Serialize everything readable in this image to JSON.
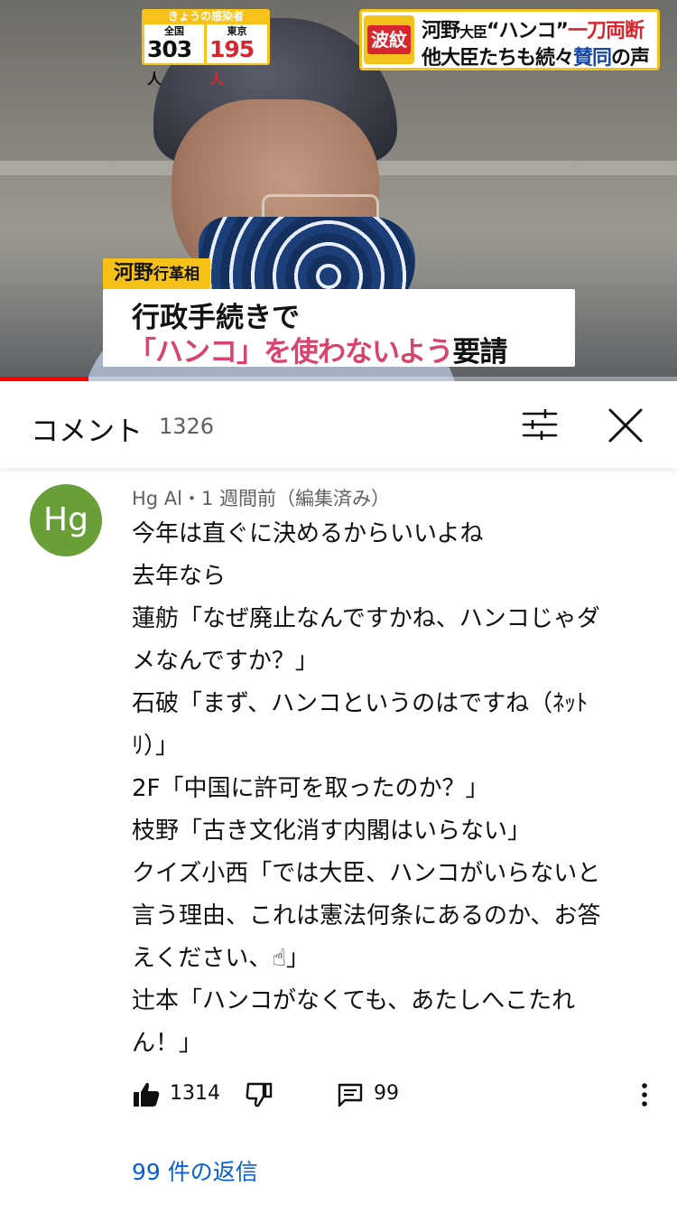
{
  "video": {
    "infection": {
      "title": "きょうの感染者",
      "national_label": "全国",
      "national_value": "303",
      "tokyo_label": "東京",
      "tokyo_value": "195",
      "unit": "人"
    },
    "headline": {
      "tag": "波紋",
      "line1_a": "河野",
      "line1_b": "大臣",
      "line1_c": "“ハンコ”",
      "line1_d": "一刀両断",
      "line2_a": "他大臣たちも続々",
      "line2_b": "賛同",
      "line2_c": "の声"
    },
    "caption": {
      "name": "河野",
      "role": "行革相",
      "line1": "行政手続きで",
      "line2_a": "「ハンコ」を使わないよう",
      "line2_b": "要請"
    },
    "progress": 0.13,
    "colors": {
      "accent_yellow": "#f3c21c",
      "accent_red": "#d8262f",
      "progress_red": "#ff0000"
    }
  },
  "comments_header": {
    "title": "コメント",
    "count": "1326",
    "sort_icon": "sliders-icon",
    "close_icon": "close-icon"
  },
  "comment": {
    "avatar_text": "Hg",
    "avatar_color": "#689f38",
    "meta": "Hg Al・1 週間前（編集済み）",
    "lines": [
      "今年は直ぐに決めるからいいよね",
      "去年なら",
      "蓮舫「なぜ廃止なんですかね、ハンコじゃダ",
      "メなんですか？」",
      "石破「まず、ハンコというのはですね（ﾈｯﾄ",
      "ﾘ）」",
      "2F「中国に許可を取ったのか？」",
      "枝野「古き文化消す内閣はいらない」",
      "クイズ小西「では大臣、ハンコがいらないと",
      "言う理由、これは憲法何条にあるのか、お答",
      "えください、☝」",
      "辻本「ハンコがなくても、あたしへこたれ",
      "ん！」"
    ],
    "likes": "1314",
    "replies_count": "99",
    "replies_link": "99 件の返信",
    "link_color": "#065fd4"
  }
}
